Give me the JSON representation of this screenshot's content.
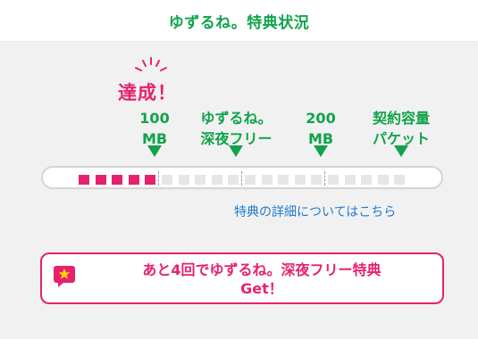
{
  "header": {
    "title": "ゆずるね。特典状況"
  },
  "status": {
    "achieved_label": "達成！"
  },
  "milestones": [
    {
      "line1": "100",
      "line2": "MB"
    },
    {
      "line1": "ゆずるね。",
      "line2": "深夜フリー"
    },
    {
      "line1": "200",
      "line2": "MB"
    },
    {
      "line1": "契約容量",
      "line2": "パケット"
    }
  ],
  "progress": {
    "filled_segments": 5,
    "total_segments": 20
  },
  "details_link": "特典の詳細についてはこちら",
  "promo": {
    "line1": "あと4回でゆずるね。深夜フリー特典",
    "line2": "Get！",
    "icon": "star-speech-bubble-icon"
  },
  "colors": {
    "accent_green": "#10a34a",
    "accent_pink": "#e6226f",
    "link_blue": "#1f7bd1",
    "segment_empty": "#e6e6e6"
  }
}
